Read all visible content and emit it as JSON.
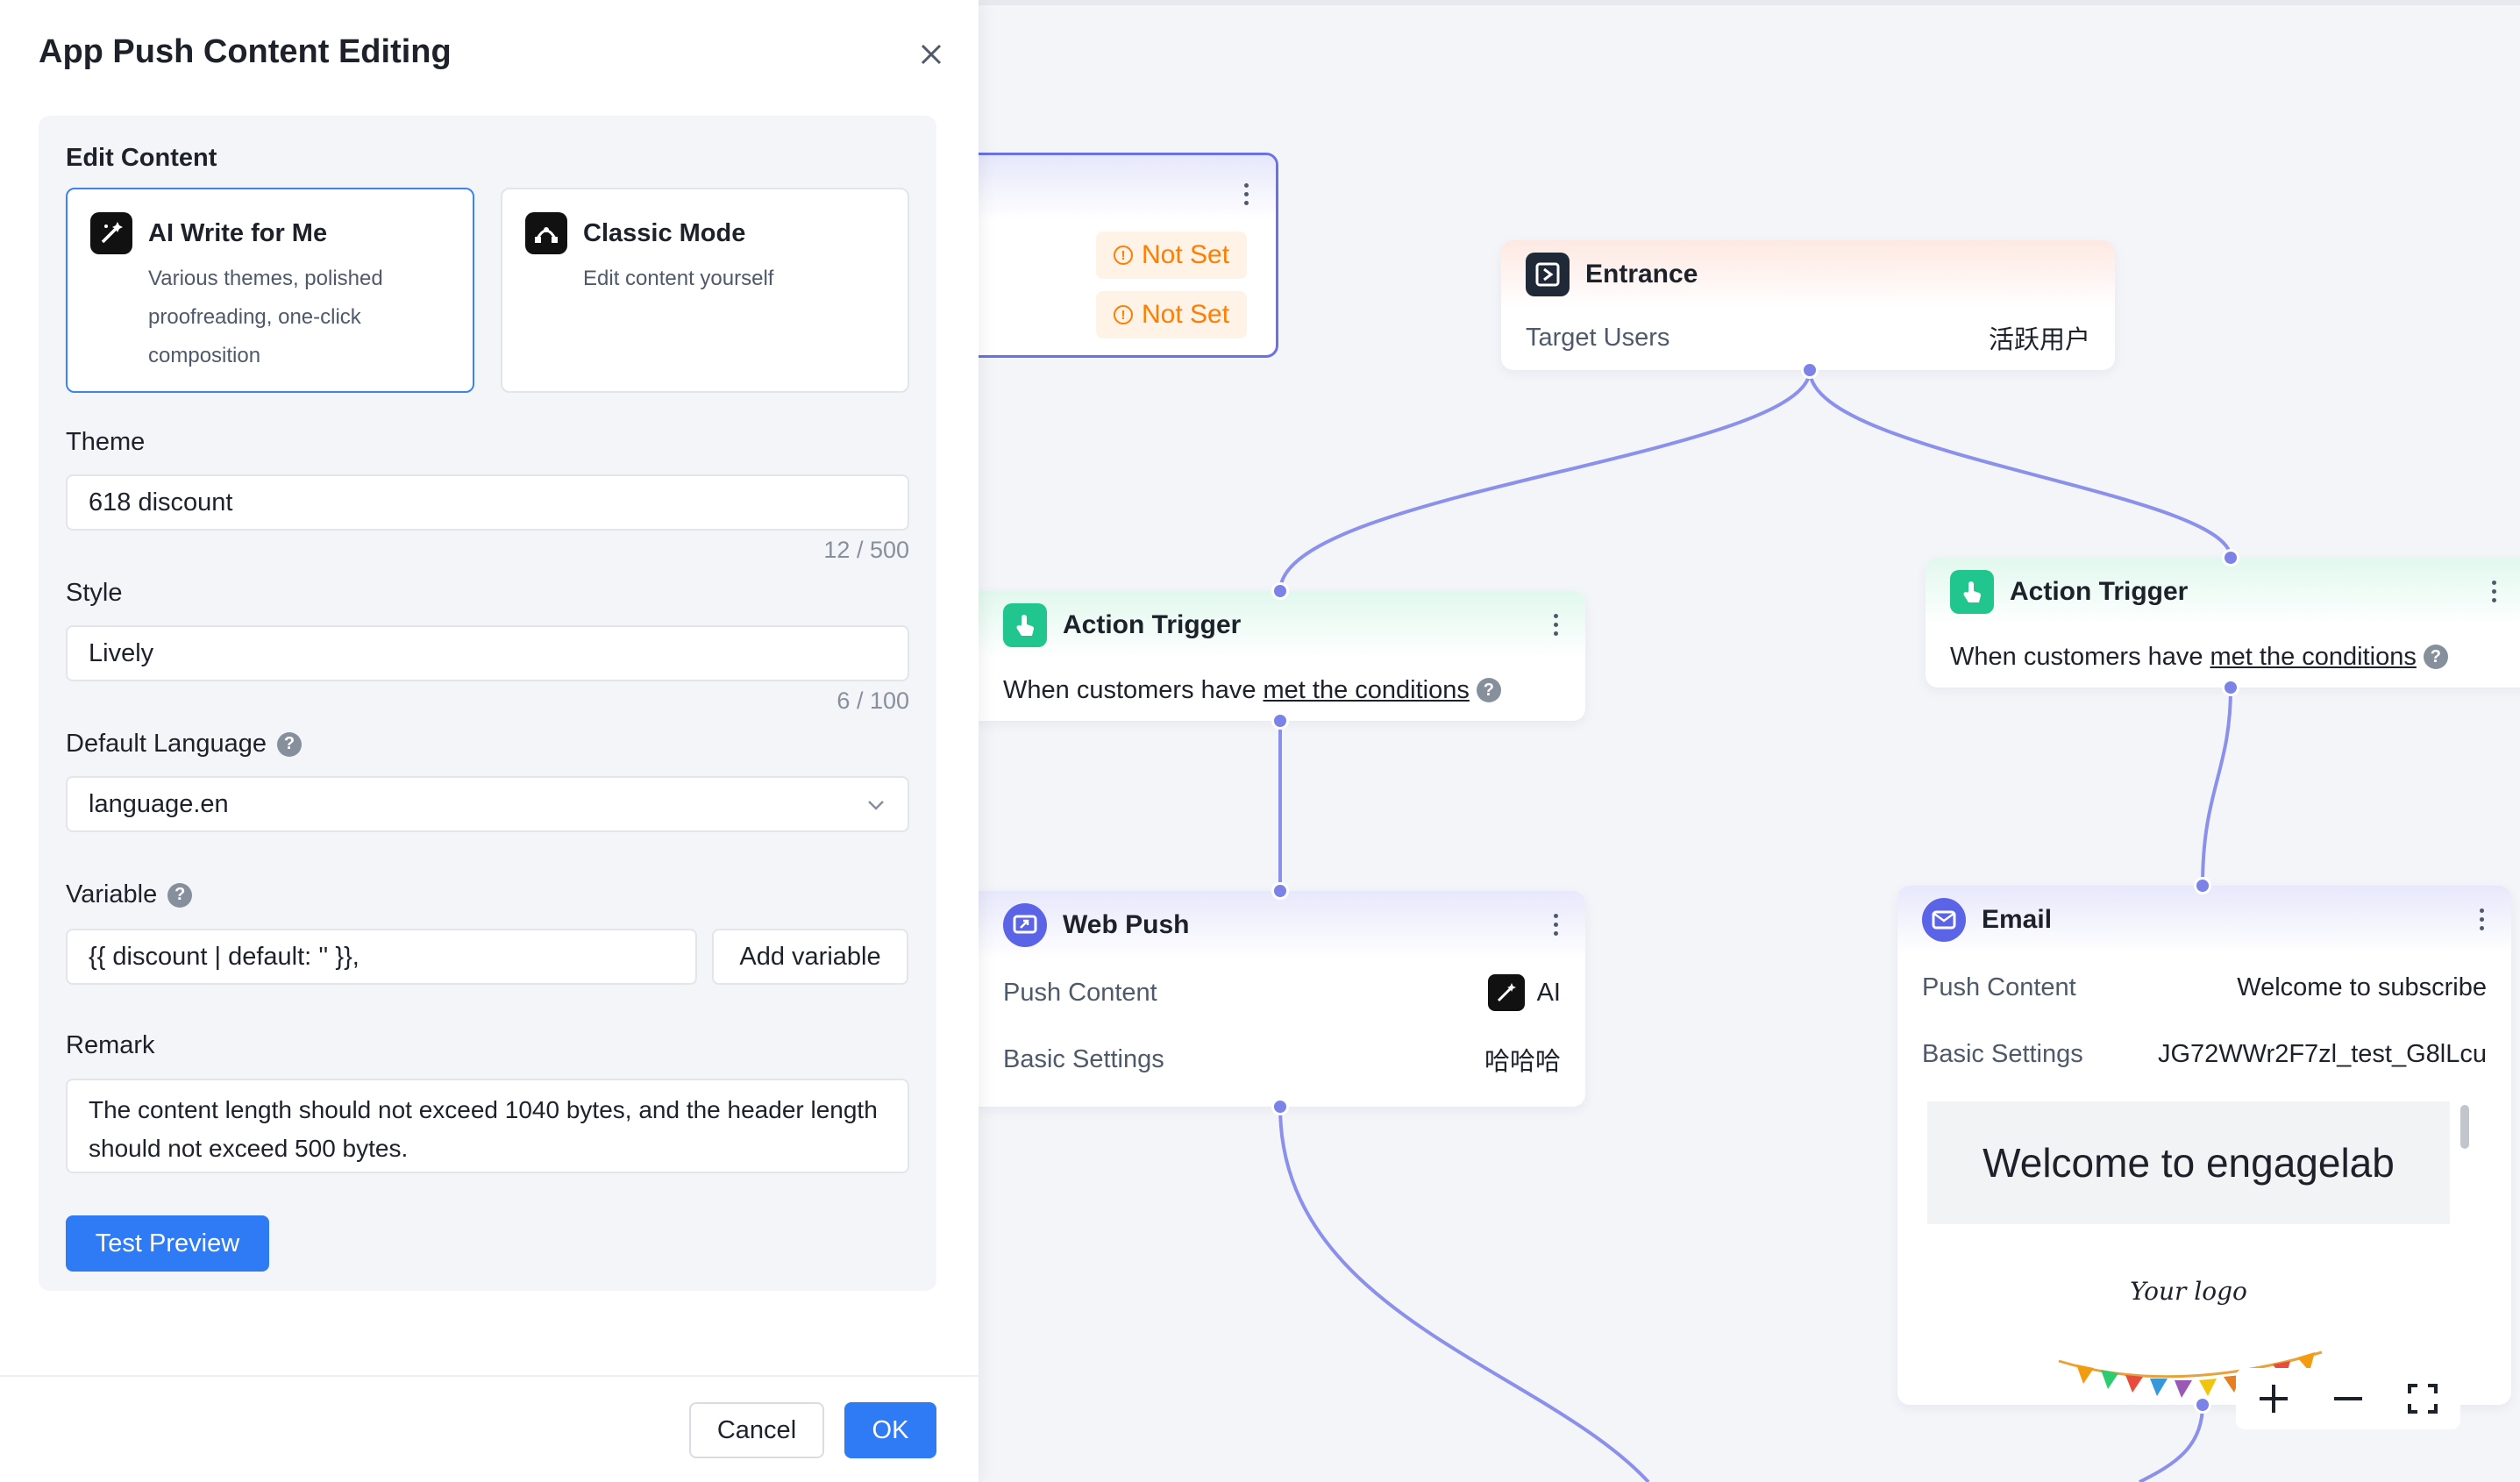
{
  "modal": {
    "title": "App Push Content Editing",
    "edit_content_label": "Edit Content",
    "modes": [
      {
        "title": "AI Write for Me",
        "desc": "Various themes, polished proofreading, one-click composition",
        "selected": true
      },
      {
        "title": "Classic Mode",
        "desc": "Edit content yourself",
        "selected": false
      }
    ],
    "theme": {
      "label": "Theme",
      "value": "618 discount",
      "counter": "12 / 500"
    },
    "style": {
      "label": "Style",
      "value": "Lively",
      "counter": "6 / 100"
    },
    "language": {
      "label": "Default Language",
      "value": "language.en"
    },
    "variable": {
      "label": "Variable",
      "value": "{{ discount | default: '' }},",
      "add_label": "Add variable"
    },
    "remark": {
      "label": "Remark",
      "value": "The content length should not exceed 1040 bytes, and the header length should not exceed 500 bytes."
    },
    "test_preview_label": "Test Preview",
    "cancel_label": "Cancel",
    "ok_label": "OK"
  },
  "canvas": {
    "partial_node": {
      "not_set_1": "Not Set",
      "not_set_2": "Not Set"
    },
    "entrance": {
      "title": "Entrance",
      "row_label": "Target Users",
      "row_value": "活跃用户"
    },
    "action_trigger_left": {
      "title": "Action Trigger",
      "cond_prefix": "When customers have",
      "cond_link": "met the conditions"
    },
    "action_trigger_right": {
      "title": "Action Trigger",
      "cond_prefix": "When customers have",
      "cond_link": "met the conditions"
    },
    "web_push": {
      "title": "Web Push",
      "rows": [
        {
          "label": "Push Content",
          "value": "AI"
        },
        {
          "label": "Basic Settings",
          "value": "哈哈哈"
        }
      ]
    },
    "email": {
      "title": "Email",
      "rows": [
        {
          "label": "Push Content",
          "value": "Welcome to subscribe"
        },
        {
          "label": "Basic Settings",
          "value": "JG72WWr2F7zl_test_G8lLcu"
        }
      ],
      "preview_heading": "Welcome to engagelab",
      "preview_logo": "Your logo"
    }
  },
  "colors": {
    "primary": "#2f7bf5",
    "edge": "#7b82e8",
    "warning": "#ff7d00",
    "trigger_icon": "#21c58e",
    "email_icon": "#5b63e6"
  }
}
